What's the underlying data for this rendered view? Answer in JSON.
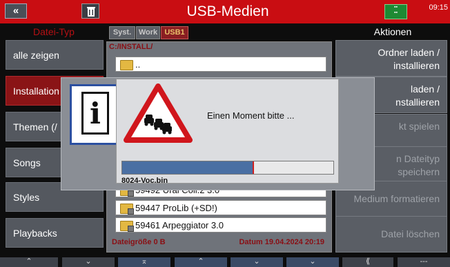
{
  "header": {
    "title": "USB-Medien",
    "clock": "09:15",
    "back_icon": "«"
  },
  "left_panel": {
    "title": "Datei-Typ",
    "items": [
      {
        "label": "alle zeigen",
        "selected": false
      },
      {
        "label": "Installation",
        "selected": true
      },
      {
        "label": "Themen (/",
        "selected": false
      },
      {
        "label": "Songs",
        "selected": false
      },
      {
        "label": "Styles",
        "selected": false
      },
      {
        "label": "Playbacks",
        "selected": false
      }
    ]
  },
  "tabs": [
    {
      "label": "Syst.",
      "active": false
    },
    {
      "label": "Work",
      "active": false
    },
    {
      "label": "USB1",
      "active": true
    }
  ],
  "browser": {
    "path": "C:/INSTALL/",
    "rows": [
      {
        "name": ".."
      },
      {
        "name": "59492 Ural Coll.2 3.0"
      },
      {
        "name": "59447 ProLib (+SD!)"
      },
      {
        "name": "59461 Arpeggiator 3.0"
      }
    ],
    "footer_size": "Dateigröße 0 B",
    "footer_date": "Datum 19.04.2024  20:19"
  },
  "right_panel": {
    "title": "Aktionen",
    "items": [
      {
        "label": "Ordner laden  /\ninstallieren",
        "enabled": true
      },
      {
        "label": "laden  /\nnstallieren",
        "enabled": true
      },
      {
        "label": "kt spielen",
        "enabled": false
      },
      {
        "label": "n Dateityp\nspeichern",
        "enabled": false
      },
      {
        "label": "Medium formatieren",
        "enabled": false
      },
      {
        "label": "Datei löschen",
        "enabled": false
      }
    ]
  },
  "bottom_bar": {
    "buttons": [
      "⌃",
      "⌄",
      "⌅",
      "⌃",
      "⌄",
      "⌄",
      "⟪",
      "---"
    ]
  },
  "dialog": {
    "message": "Einen Moment bitte ...",
    "progress": 0.62,
    "filename": "8024-Voc.bin"
  },
  "colors": {
    "accent": "#c90d12",
    "progress": "#4a6fa3"
  }
}
